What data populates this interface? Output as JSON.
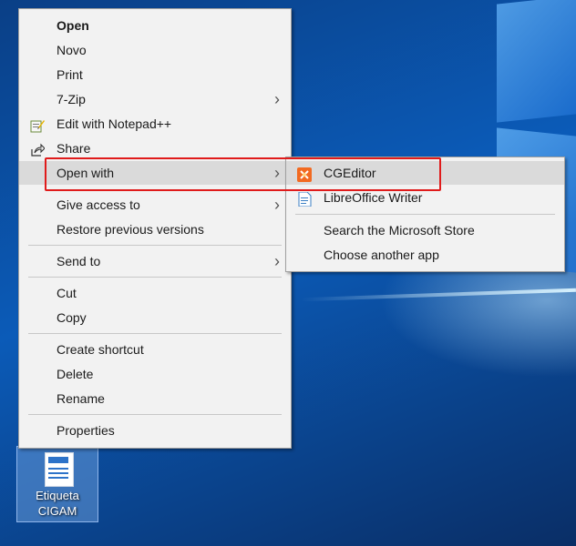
{
  "context_menu": {
    "items": [
      {
        "label": "Open"
      },
      {
        "label": "Novo"
      },
      {
        "label": "Print"
      },
      {
        "label": "7-Zip"
      },
      {
        "label": "Edit with Notepad++"
      },
      {
        "label": "Share"
      },
      {
        "label": "Open with"
      },
      {
        "label": "Give access to"
      },
      {
        "label": "Restore previous versions"
      },
      {
        "label": "Send to"
      },
      {
        "label": "Cut"
      },
      {
        "label": "Copy"
      },
      {
        "label": "Create shortcut"
      },
      {
        "label": "Delete"
      },
      {
        "label": "Rename"
      },
      {
        "label": "Properties"
      }
    ]
  },
  "open_with_menu": {
    "items": [
      {
        "label": "CGEditor"
      },
      {
        "label": "LibreOffice Writer"
      },
      {
        "label": "Search the Microsoft Store"
      },
      {
        "label": "Choose another app"
      }
    ]
  },
  "desktop_icon": {
    "line1": "Etiqueta",
    "line2": "CIGAM"
  },
  "colors": {
    "highlight_border": "#e01b1b",
    "menu_bg": "#f2f2f2",
    "hover_bg": "#dadada"
  }
}
